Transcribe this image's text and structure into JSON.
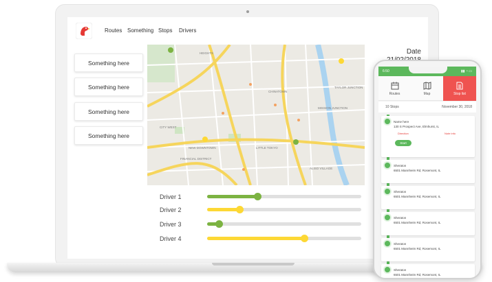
{
  "nav": {
    "items": [
      "Routes",
      "Something",
      "Stops",
      "Drivers"
    ],
    "logo_icon": "rooster-logo-icon"
  },
  "cards": [
    "Something here",
    "Something here",
    "Something here",
    "Something here"
  ],
  "date": {
    "label": "Date",
    "value": "21/02/2018"
  },
  "map": {
    "labels": [
      "CHINATOWN",
      "CITY WEST",
      "NEW DOWNTOWN",
      "FINANCIAL DISTRICT",
      "LITTLE TOKYO",
      "TAYLOR JUNCTION",
      "MISSION JUNCTION",
      "ALISO VILLAGE",
      "HEIGHTS"
    ]
  },
  "drivers": [
    {
      "label": "Driver 1",
      "level": 0.33,
      "color": "#7cb342"
    },
    {
      "label": "Driver 2",
      "level": 0.21,
      "color": "#fdd835"
    },
    {
      "label": "Driver 3",
      "level": 0.08,
      "color": "#7cb342"
    },
    {
      "label": "Driver 4",
      "level": 0.63,
      "color": "#fdd835"
    }
  ],
  "phone": {
    "time": "6:50",
    "tabs": [
      {
        "label": "Routes",
        "icon": "calendar-icon"
      },
      {
        "label": "Map",
        "icon": "map-icon"
      },
      {
        "label": "Stop list",
        "icon": "document-icon"
      }
    ],
    "stops_count": "10 Stops",
    "stops_date": "November 30, 2018",
    "stops": [
      {
        "name": "Name here",
        "address": "130 S Prospect Ave, Elmhurst, IL",
        "tag_left": "Direction",
        "tag_right": "Note info",
        "start_label": "Start"
      },
      {
        "name": "Sheraton",
        "address": "6501 Mannheim Rd, Rosemont, IL"
      },
      {
        "name": "Sheraton",
        "address": "6501 Mannheim Rd, Rosemont, IL"
      },
      {
        "name": "Sheraton",
        "address": "6501 Mannheim Rd, Rosemont, IL"
      },
      {
        "name": "Sheraton",
        "address": "6501 Mannheim Rd, Rosemont, IL"
      },
      {
        "name": "Sheraton",
        "address": "6501 Mannheim Rd, Rosemont, IL"
      }
    ]
  },
  "colors": {
    "green": "#5cb85c",
    "yellow": "#fdd835",
    "red": "#ef5350"
  }
}
